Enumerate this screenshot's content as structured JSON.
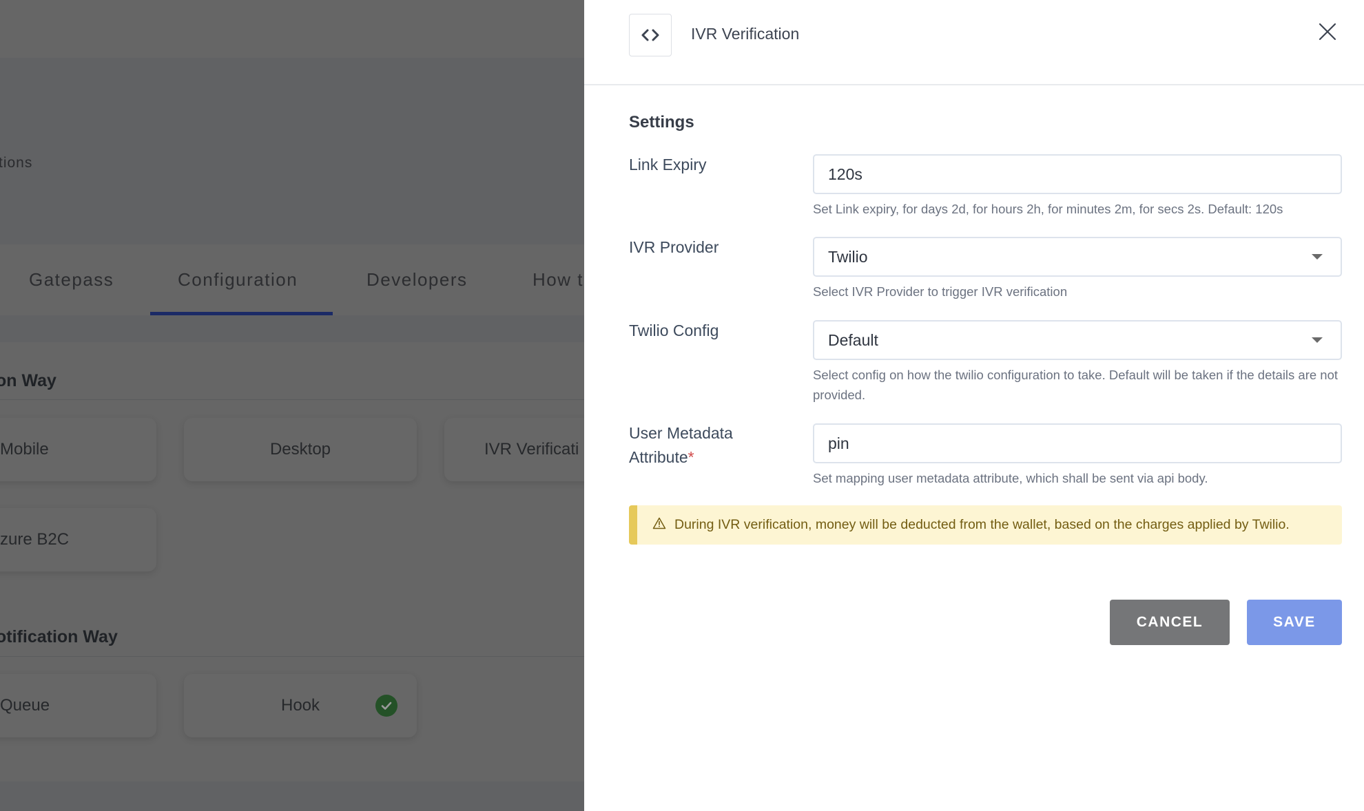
{
  "background": {
    "header_text": "tions",
    "tabs": [
      {
        "label": "Gatepass",
        "active": false
      },
      {
        "label": "Configuration",
        "active": true
      },
      {
        "label": "Developers",
        "active": false
      },
      {
        "label": "How t",
        "active": false
      }
    ],
    "sections": [
      {
        "title": "on Way",
        "cards": [
          {
            "label": "Mobile",
            "selected": false
          },
          {
            "label": "Desktop",
            "selected": false
          },
          {
            "label": "IVR Verificati",
            "selected": false
          },
          {
            "label": "zure B2C",
            "selected": false
          }
        ]
      },
      {
        "title": "otification Way",
        "cards": [
          {
            "label": "Queue",
            "selected": false
          },
          {
            "label": "Hook",
            "selected": true
          }
        ]
      }
    ],
    "colors": {
      "tab_active_underline": "#1b2a66",
      "selected_check": "#245127"
    }
  },
  "drawer": {
    "icon": "code-brackets-icon",
    "title": "IVR Verification",
    "close_icon": "close-icon",
    "settings_heading": "Settings",
    "fields": {
      "link_expiry": {
        "label": "Link Expiry",
        "value": "120s",
        "help": "Set Link expiry, for days 2d, for hours 2h, for minutes 2m, for secs 2s. Default: 120s"
      },
      "ivr_provider": {
        "label": "IVR Provider",
        "value": "Twilio",
        "help": "Select IVR Provider to trigger IVR verification"
      },
      "twilio_config": {
        "label": "Twilio Config",
        "value": "Default",
        "help": "Select config on how the twilio configuration to take. Default will be taken if the details are not provided."
      },
      "user_metadata_attribute": {
        "label_line1": "User Metadata",
        "label_line2": "Attribute",
        "required_mark": "*",
        "value": "pin",
        "help": "Set mapping user metadata attribute, which shall be sent via api body."
      }
    },
    "alert": {
      "icon": "warning-icon",
      "text": "During IVR verification, money will be deducted from the wallet, based on the charges applied by Twilio."
    },
    "buttons": {
      "cancel": "CANCEL",
      "save": "SAVE"
    },
    "colors": {
      "cancel_button": "#757678",
      "save_button": "#7b98e8",
      "alert_bg": "#fdf5d3",
      "alert_accent": "#e6c95a",
      "required": "#d04a4a"
    }
  }
}
